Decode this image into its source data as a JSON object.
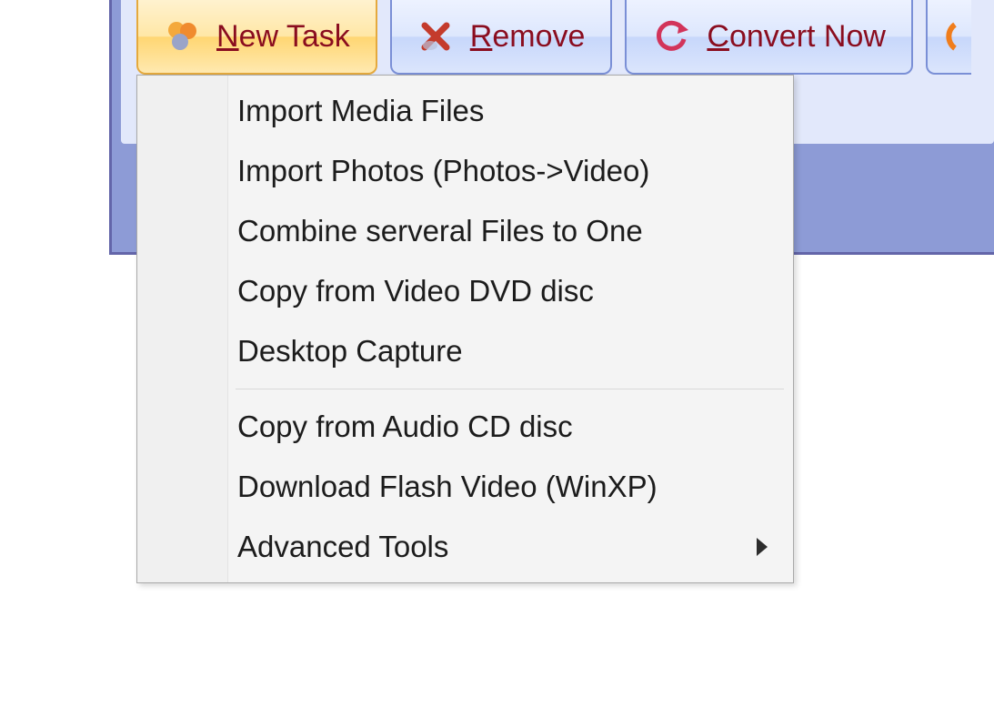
{
  "toolbar": {
    "new_task": {
      "prefix": "N",
      "rest": "ew Task"
    },
    "remove": {
      "prefix": "R",
      "rest": "emove"
    },
    "convert": {
      "prefix": "C",
      "rest": "onvert Now"
    }
  },
  "menu": {
    "group1": [
      "Import Media Files",
      "Import Photos (Photos->Video)",
      "Combine serveral Files to One",
      "Copy from Video DVD disc",
      "Desktop Capture"
    ],
    "group2": [
      "Copy from Audio CD disc",
      "Download Flash Video (WinXP)"
    ],
    "submenu_label": "Advanced Tools"
  }
}
